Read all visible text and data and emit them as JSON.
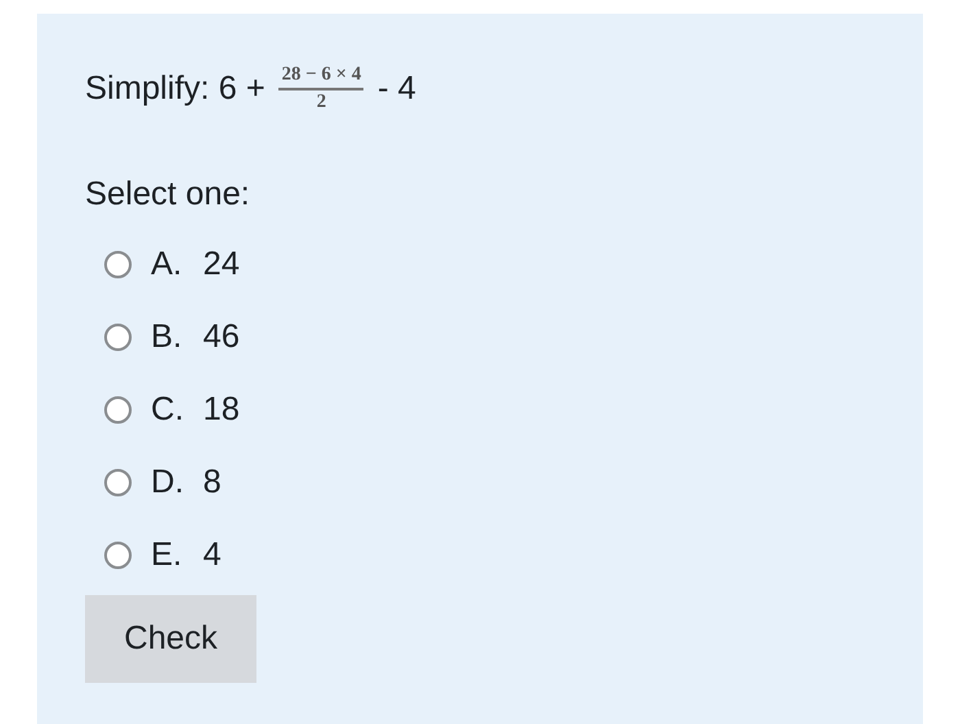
{
  "question": {
    "prefix": "Simplify: 6 +",
    "numerator": "28 − 6 × 4",
    "denominator": "2",
    "suffix": "- 4"
  },
  "prompt": "Select one:",
  "options": [
    {
      "letter": "A.",
      "value": "24",
      "selected": false
    },
    {
      "letter": "B.",
      "value": "46",
      "selected": false
    },
    {
      "letter": "C.",
      "value": "18",
      "selected": false
    },
    {
      "letter": "D.",
      "value": "8",
      "selected": false
    },
    {
      "letter": "E.",
      "value": "4",
      "selected": false
    }
  ],
  "button": "Check"
}
